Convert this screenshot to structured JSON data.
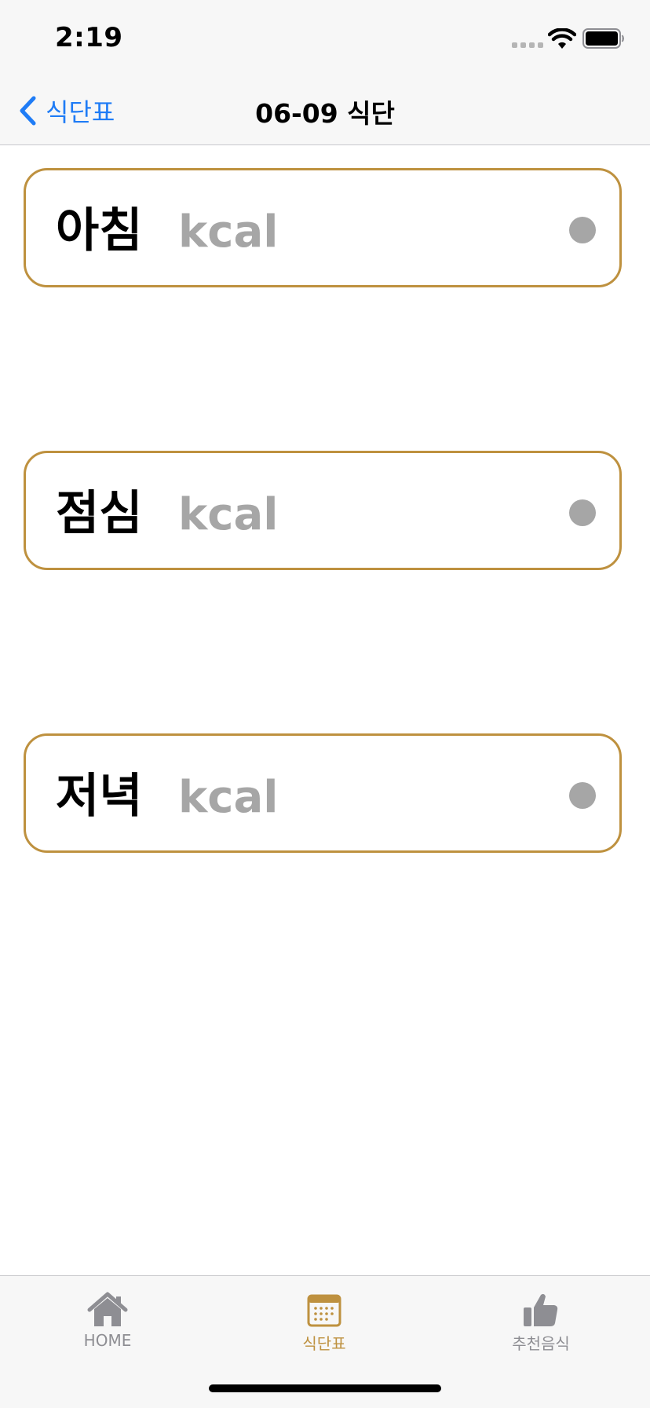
{
  "status_bar": {
    "time": "2:19"
  },
  "nav": {
    "back_label": "식단표",
    "title": "06-09 식단"
  },
  "meals": [
    {
      "name": "아침",
      "kcal_label": "kcal"
    },
    {
      "name": "점심",
      "kcal_label": "kcal"
    },
    {
      "name": "저녁",
      "kcal_label": "kcal"
    }
  ],
  "tabs": [
    {
      "label": "HOME",
      "icon": "house-icon",
      "active": false
    },
    {
      "label": "식단표",
      "icon": "calendar-icon",
      "active": true
    },
    {
      "label": "추천음식",
      "icon": "thumbs-up-icon",
      "active": false
    }
  ],
  "colors": {
    "accent": "#be913f",
    "link_blue": "#1f7cf6",
    "muted_gray": "#a6a6a6"
  }
}
